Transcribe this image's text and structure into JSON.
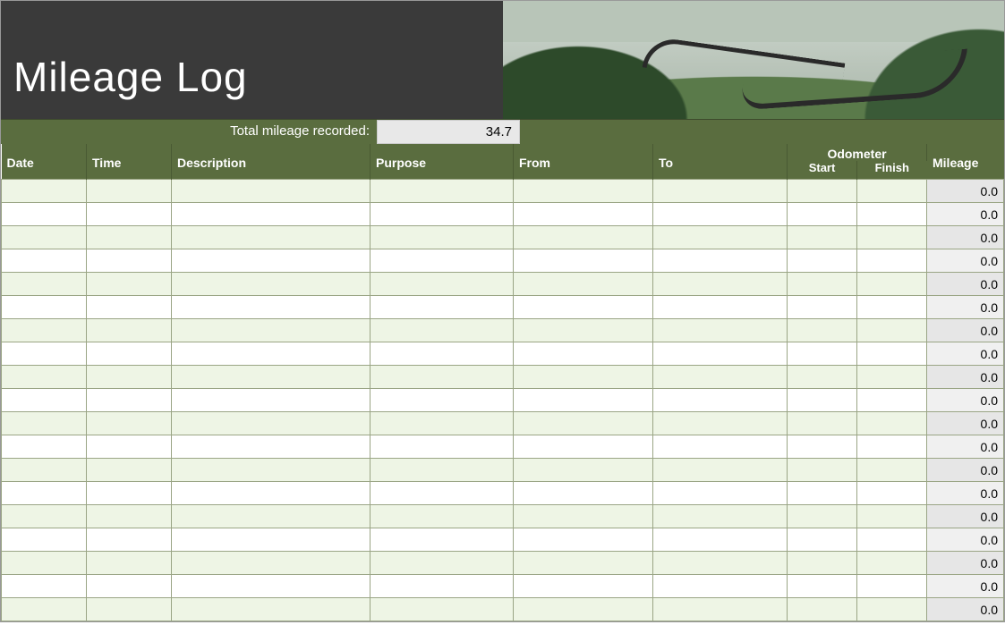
{
  "header": {
    "title": "Mileage Log",
    "total_label": "Total mileage recorded:",
    "total_value": "34.7"
  },
  "columns": {
    "date": "Date",
    "time": "Time",
    "description": "Description",
    "purpose": "Purpose",
    "from": "From",
    "to": "To",
    "odometer_group": "Odometer",
    "odometer_start": "Start",
    "odometer_finish": "Finish",
    "mileage": "Mileage"
  },
  "rows": [
    {
      "date": "",
      "time": "",
      "description": "",
      "purpose": "",
      "from": "",
      "to": "",
      "start": "",
      "finish": "",
      "mileage": "0.0"
    },
    {
      "date": "",
      "time": "",
      "description": "",
      "purpose": "",
      "from": "",
      "to": "",
      "start": "",
      "finish": "",
      "mileage": "0.0"
    },
    {
      "date": "",
      "time": "",
      "description": "",
      "purpose": "",
      "from": "",
      "to": "",
      "start": "",
      "finish": "",
      "mileage": "0.0"
    },
    {
      "date": "",
      "time": "",
      "description": "",
      "purpose": "",
      "from": "",
      "to": "",
      "start": "",
      "finish": "",
      "mileage": "0.0"
    },
    {
      "date": "",
      "time": "",
      "description": "",
      "purpose": "",
      "from": "",
      "to": "",
      "start": "",
      "finish": "",
      "mileage": "0.0"
    },
    {
      "date": "",
      "time": "",
      "description": "",
      "purpose": "",
      "from": "",
      "to": "",
      "start": "",
      "finish": "",
      "mileage": "0.0"
    },
    {
      "date": "",
      "time": "",
      "description": "",
      "purpose": "",
      "from": "",
      "to": "",
      "start": "",
      "finish": "",
      "mileage": "0.0"
    },
    {
      "date": "",
      "time": "",
      "description": "",
      "purpose": "",
      "from": "",
      "to": "",
      "start": "",
      "finish": "",
      "mileage": "0.0"
    },
    {
      "date": "",
      "time": "",
      "description": "",
      "purpose": "",
      "from": "",
      "to": "",
      "start": "",
      "finish": "",
      "mileage": "0.0"
    },
    {
      "date": "",
      "time": "",
      "description": "",
      "purpose": "",
      "from": "",
      "to": "",
      "start": "",
      "finish": "",
      "mileage": "0.0"
    },
    {
      "date": "",
      "time": "",
      "description": "",
      "purpose": "",
      "from": "",
      "to": "",
      "start": "",
      "finish": "",
      "mileage": "0.0"
    },
    {
      "date": "",
      "time": "",
      "description": "",
      "purpose": "",
      "from": "",
      "to": "",
      "start": "",
      "finish": "",
      "mileage": "0.0"
    },
    {
      "date": "",
      "time": "",
      "description": "",
      "purpose": "",
      "from": "",
      "to": "",
      "start": "",
      "finish": "",
      "mileage": "0.0"
    },
    {
      "date": "",
      "time": "",
      "description": "",
      "purpose": "",
      "from": "",
      "to": "",
      "start": "",
      "finish": "",
      "mileage": "0.0"
    },
    {
      "date": "",
      "time": "",
      "description": "",
      "purpose": "",
      "from": "",
      "to": "",
      "start": "",
      "finish": "",
      "mileage": "0.0"
    },
    {
      "date": "",
      "time": "",
      "description": "",
      "purpose": "",
      "from": "",
      "to": "",
      "start": "",
      "finish": "",
      "mileage": "0.0"
    },
    {
      "date": "",
      "time": "",
      "description": "",
      "purpose": "",
      "from": "",
      "to": "",
      "start": "",
      "finish": "",
      "mileage": "0.0"
    },
    {
      "date": "",
      "time": "",
      "description": "",
      "purpose": "",
      "from": "",
      "to": "",
      "start": "",
      "finish": "",
      "mileage": "0.0"
    },
    {
      "date": "",
      "time": "",
      "description": "",
      "purpose": "",
      "from": "",
      "to": "",
      "start": "",
      "finish": "",
      "mileage": "0.0"
    }
  ]
}
